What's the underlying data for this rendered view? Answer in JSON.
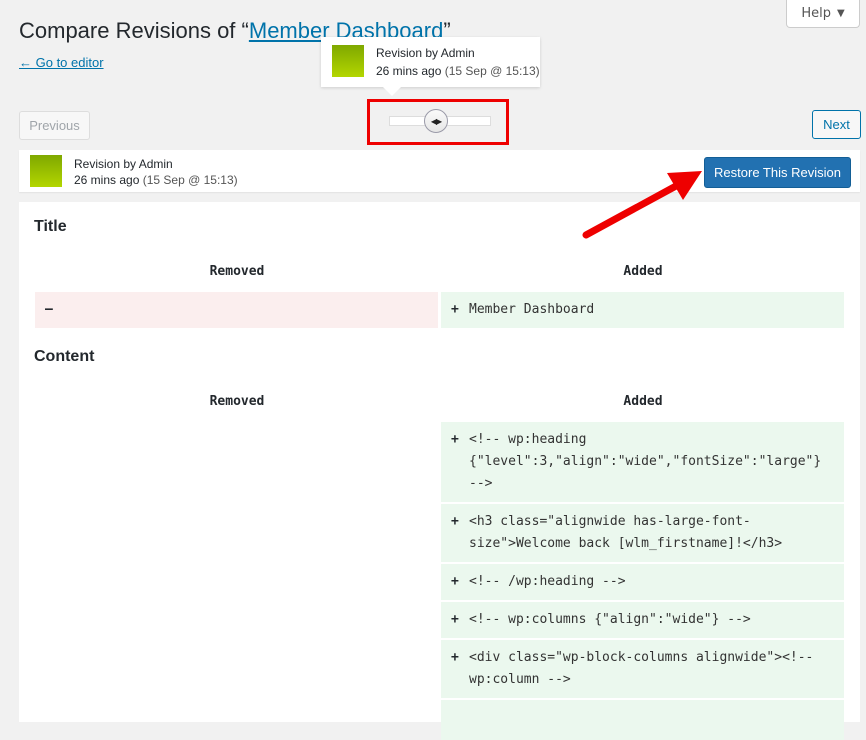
{
  "help": {
    "label": "Help",
    "caret": "▼"
  },
  "page": {
    "title_prefix": "Compare Revisions of “",
    "title_link": "Member Dashboard",
    "title_suffix": "”",
    "go_to_editor": "← Go to editor"
  },
  "tooltip": {
    "line1_prefix": "Revision by ",
    "author": "Admin",
    "time_ago": "26 mins ago",
    "date": "(15 Sep @ 15:13)"
  },
  "slider": {
    "handle_glyph": "◀▶",
    "position_fraction": 0.4
  },
  "nav": {
    "previous_label": "Previous",
    "next_label": "Next"
  },
  "revision": {
    "line1_prefix": "Revision by ",
    "author": "Admin",
    "time_ago": "26 mins ago",
    "date": "(15 Sep @ 15:13)",
    "restore_label": "Restore This Revision"
  },
  "diff": {
    "sections": [
      {
        "title": "Title",
        "removed_header": "Removed",
        "added_header": "Added",
        "removed_sign": "–",
        "added_sign": "+",
        "added_text": "Member Dashboard"
      },
      {
        "title": "Content",
        "removed_header": "Removed",
        "added_header": "Added",
        "added_sign": "+",
        "added_rows": [
          [
            "<!-- wp:heading",
            "{\"level\":3,\"align\":\"wide\",\"fontSize\":\"large\"}",
            "-->"
          ],
          [
            "<h3 class=\"alignwide has-large-font-",
            "size\">Welcome back [wlm_firstname]!</h3>"
          ],
          [
            "<!-- /wp:heading -->"
          ],
          [
            "<!-- wp:columns {\"align\":\"wide\"} -->"
          ],
          [
            "<div class=\"wp-block-columns alignwide\"><!--",
            "wp:column -->"
          ]
        ]
      }
    ]
  },
  "colors": {
    "accent": "#0073aa",
    "restore_button": "#2271b1",
    "removed_bg": "#fbeeee",
    "added_bg": "#ebf8ee",
    "annotation_red": "#ee0000"
  }
}
